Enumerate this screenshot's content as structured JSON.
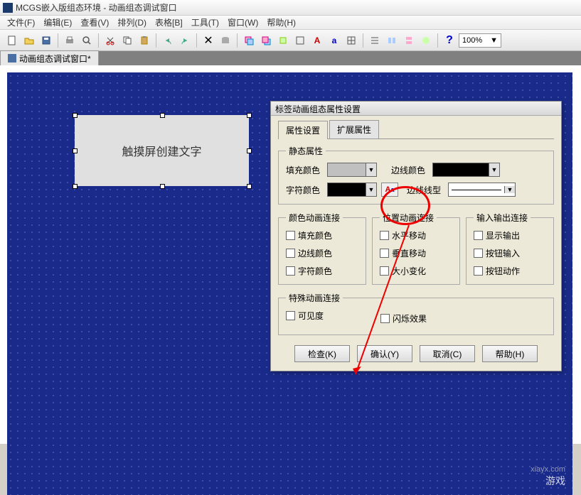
{
  "window": {
    "title": "MCGS嵌入版组态环境 - 动画组态调试窗口"
  },
  "menu": [
    "文件(F)",
    "编辑(E)",
    "查看(V)",
    "排列(D)",
    "表格[B]",
    "工具(T)",
    "窗口(W)",
    "帮助(H)"
  ],
  "zoom": "100%",
  "doc_tab": "动画组态调试窗口*",
  "canvas_label": "触摸屏创建文字",
  "dialog": {
    "title": "标签动画组态属性设置",
    "tabs": [
      "属性设置",
      "扩展属性"
    ],
    "group_static": "静态属性",
    "fill_color": "填充颜色",
    "border_color": "边线颜色",
    "char_color": "字符颜色",
    "border_line": "边线线型",
    "group_color_anim": "颜色动画连接",
    "color_checks": [
      "填充颜色",
      "边线颜色",
      "字符颜色"
    ],
    "group_pos_anim": "位置动画连接",
    "pos_checks": [
      "水平移动",
      "垂直移动",
      "大小变化"
    ],
    "group_io": "输入输出连接",
    "io_checks": [
      "显示输出",
      "按钮输入",
      "按钮动作"
    ],
    "group_special": "特殊动画连接",
    "special_checks": [
      "可见度",
      "闪烁效果"
    ],
    "buttons": {
      "check": "检查(K)",
      "ok": "确认(Y)",
      "cancel": "取消(C)",
      "help": "帮助(H)"
    }
  },
  "colors": {
    "fill": "#c0c0c0",
    "border": "#000000",
    "char": "#000000"
  },
  "watermark": {
    "text": "游戏",
    "url": "xiayx.com"
  }
}
